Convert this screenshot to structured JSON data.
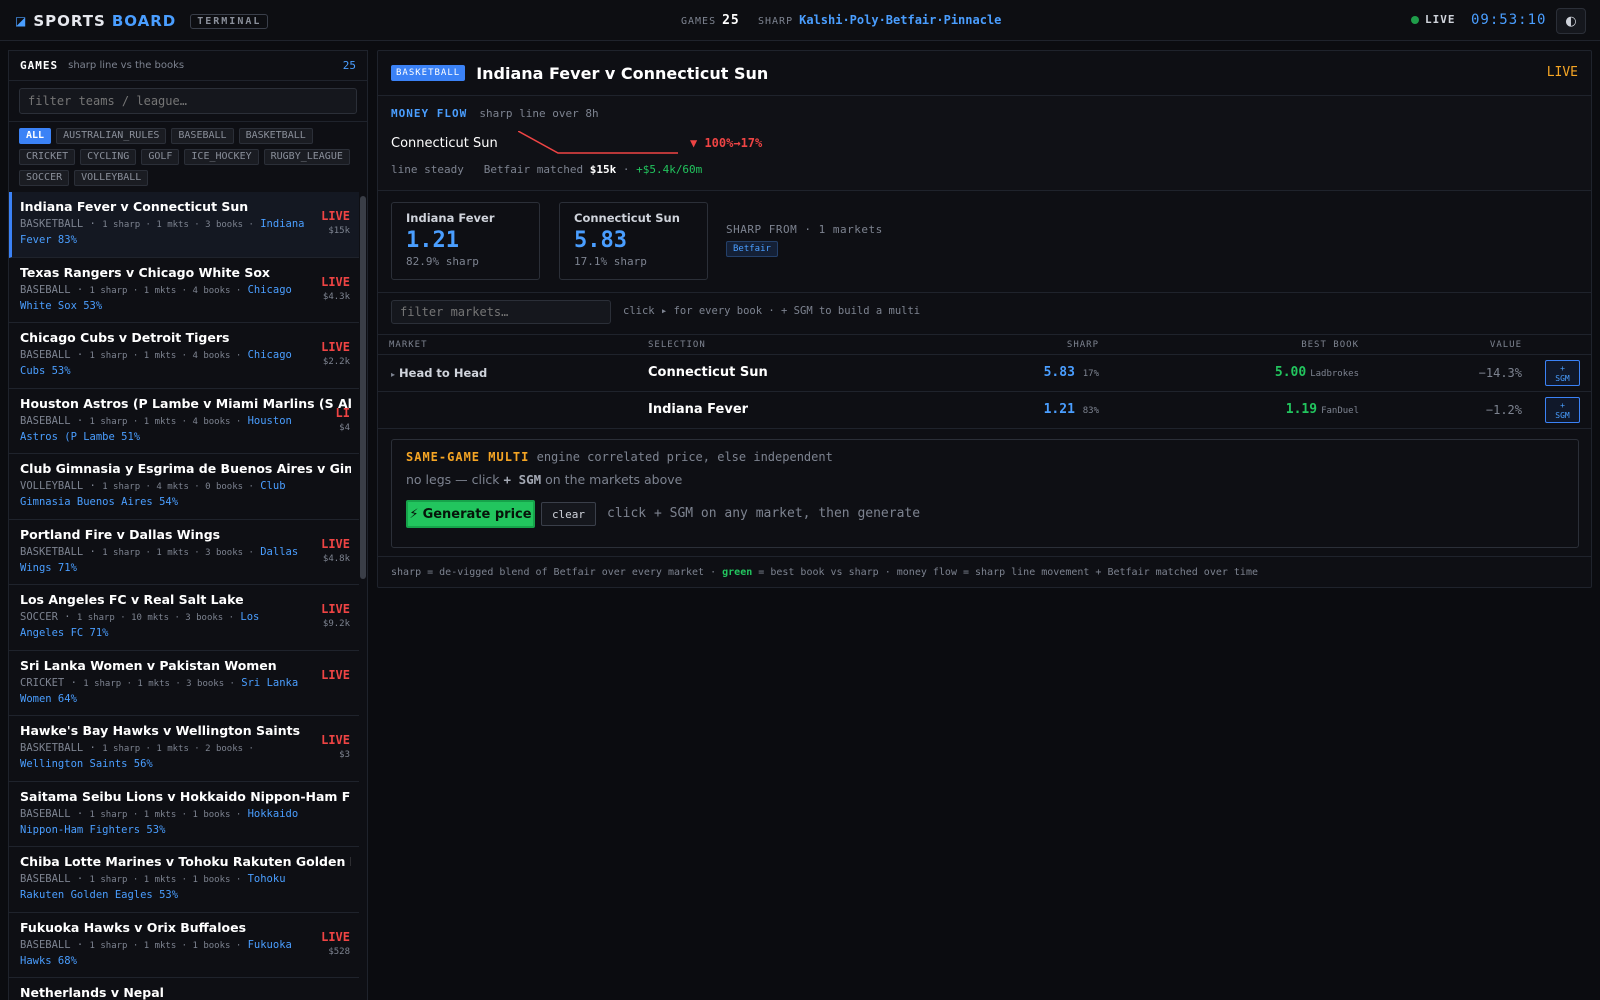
{
  "header": {
    "brand_icon": "square-icon",
    "brand_1": "SPORTS",
    "brand_2": "BOARD",
    "terminal_badge": "TERMINAL",
    "games_label": "GAMES",
    "games_count": "25",
    "sharp_label": "SHARP",
    "sharp_sources": "Kalshi·Poly·Betfair·Pinnacle",
    "live_label": "LIVE",
    "clock": "09:53:10",
    "theme_icon": "contrast-icon"
  },
  "left": {
    "title": "GAMES",
    "subtitle": "sharp line vs the books",
    "count": "25",
    "filter_placeholder": "filter teams / league…",
    "chips": [
      "ALL",
      "AUSTRALIAN_RULES",
      "BASEBALL",
      "BASKETBALL",
      "CRICKET",
      "CYCLING",
      "GOLF",
      "ICE_HOCKEY",
      "RUGBY_LEAGUE",
      "SOCCER",
      "VOLLEYBALL"
    ],
    "games": [
      {
        "name": "Indiana Fever v Connecticut Sun",
        "sport": "BASKETBALL",
        "info": "1 sharp · 1 mkts · 3 books ·",
        "pick": "Indiana Fever 83%",
        "live": "LIVE",
        "vol": "$15k"
      },
      {
        "name": "Texas Rangers v Chicago White Sox",
        "sport": "BASEBALL",
        "info": "1 sharp · 1 mkts · 4 books ·",
        "pick": "Chicago White Sox 53%",
        "live": "LIVE",
        "vol": "$4.3k"
      },
      {
        "name": "Chicago Cubs v Detroit Tigers",
        "sport": "BASEBALL",
        "info": "1 sharp · 1 mkts · 4 books ·",
        "pick": "Chicago Cubs 53%",
        "live": "LIVE",
        "vol": "$2.2k"
      },
      {
        "name": "Houston Astros (P Lambe v Miami Marlins (S Alcant",
        "sport": "BASEBALL",
        "info": "1 sharp · 1 mkts · 4 books ·",
        "pick": "Houston Astros (P Lambe 51%",
        "live": "LI",
        "vol": "$4"
      },
      {
        "name": "Club Gimnasia y Esgrima de Buenos Aires v Gimnasia E",
        "sport": "VOLLEYBALL",
        "info": "1 sharp · 4 mkts · 0 books ·",
        "pick": "Club Gimnasia Buenos Aires 54%",
        "live": "",
        "vol": ""
      },
      {
        "name": "Portland Fire v Dallas Wings",
        "sport": "BASKETBALL",
        "info": "1 sharp · 1 mkts · 3 books ·",
        "pick": "Dallas Wings 71%",
        "live": "LIVE",
        "vol": "$4.8k"
      },
      {
        "name": "Los Angeles FC v Real Salt Lake",
        "sport": "SOCCER",
        "info": "1 sharp · 10 mkts · 3 books ·",
        "pick": "Los Angeles FC 71%",
        "live": "LIVE",
        "vol": "$9.2k"
      },
      {
        "name": "Sri Lanka Women v Pakistan Women",
        "sport": "CRICKET",
        "info": "1 sharp · 1 mkts · 3 books ·",
        "pick": "Sri Lanka Women 64%",
        "live": "LIVE",
        "vol": ""
      },
      {
        "name": "Hawke's Bay Hawks v Wellington Saints",
        "sport": "BASKETBALL",
        "info": "1 sharp · 1 mkts · 2 books ·",
        "pick": "Wellington Saints 56%",
        "live": "LIVE",
        "vol": "$3"
      },
      {
        "name": "Saitama Seibu Lions v Hokkaido Nippon-Ham Fighters",
        "sport": "BASEBALL",
        "info": "1 sharp · 1 mkts · 1 books ·",
        "pick": "Hokkaido Nippon-Ham Fighters 53%",
        "live": "",
        "vol": ""
      },
      {
        "name": "Chiba Lotte Marines v Tohoku Rakuten Golden Eagles",
        "sport": "BASEBALL",
        "info": "1 sharp · 1 mkts · 1 books ·",
        "pick": "Tohoku Rakuten Golden Eagles 53%",
        "live": "",
        "vol": ""
      },
      {
        "name": "Fukuoka Hawks v Orix Buffaloes",
        "sport": "BASEBALL",
        "info": "1 sharp · 1 mkts · 1 books ·",
        "pick": "Fukuoka Hawks 68%",
        "live": "LIVE",
        "vol": "$528"
      },
      {
        "name": "Netherlands v Nepal",
        "sport": "",
        "info": "",
        "pick": "",
        "live": "",
        "vol": ""
      }
    ]
  },
  "event": {
    "sport": "BASKETBALL",
    "title": "Indiana Fever v Connecticut Sun",
    "live": "LIVE",
    "flow": {
      "label": "MONEY FLOW",
      "sub": "sharp line over 8h",
      "team": "Connecticut Sun",
      "change": "▼ 100%→17%",
      "steady": "line steady",
      "matched_label": "Betfair matched",
      "matched": "$15k",
      "sep": "·",
      "rate": "+$5.4k/60m"
    },
    "cards": [
      {
        "name": "Indiana Fever",
        "odds": "1.21",
        "sharp": "82.9% sharp"
      },
      {
        "name": "Connecticut Sun",
        "odds": "5.83",
        "sharp": "17.1% sharp"
      }
    ],
    "sharp_from": "SHARP FROM · 1 markets",
    "sharp_source": "Betfair",
    "market_filter_placeholder": "filter markets…",
    "market_hint": "click ▸ for every book · + SGM to build a multi",
    "columns": {
      "market": "MARKET",
      "selection": "SELECTION",
      "sharp": "SHARP",
      "best": "BEST BOOK",
      "value": "VALUE"
    },
    "rows": [
      {
        "market": "Head to Head",
        "selection": "Connecticut Sun",
        "sharp": "5.83",
        "sharp_pct": "17%",
        "best": "5.00",
        "book": "Ladbrokes",
        "value": "−14.3%",
        "sgm": "+ SGM"
      },
      {
        "market": "",
        "selection": "Indiana Fever",
        "sharp": "1.21",
        "sharp_pct": "83%",
        "best": "1.19",
        "book": "FanDuel",
        "value": "−1.2%",
        "sgm": "+ SGM"
      }
    ],
    "sgm": {
      "title": "SAME-GAME MULTI",
      "desc": "engine correlated price, else independent",
      "legs_pre": "no legs — click",
      "legs_btn": "+ SGM",
      "legs_post": "on the markets above",
      "generate": "Generate price",
      "clear": "clear",
      "hint": "click + SGM on any market, then generate"
    },
    "footnote_1": "sharp = de-vigged blend of Betfair over every market ·",
    "footnote_green": "green",
    "footnote_2": "= best book vs sharp · money flow = sharp line movement + Betfair matched over time"
  },
  "colors": {
    "accent": "#3b82f6",
    "live": "#ef4444",
    "positive": "#22c55e",
    "warning": "#f5a524"
  }
}
